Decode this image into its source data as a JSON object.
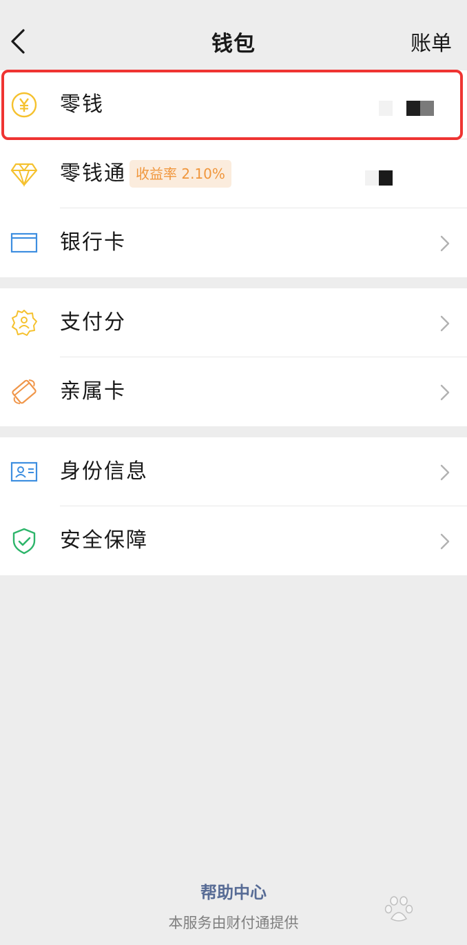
{
  "header": {
    "back_icon": "chevron-left-icon",
    "title": "钱包",
    "right_action": "账单"
  },
  "group1": {
    "change": {
      "label": "零钱",
      "icon": "yuan-coin-icon",
      "icon_color": "#f5c12e"
    },
    "licaitong": {
      "label": "零钱通",
      "icon": "diamond-icon",
      "icon_color": "#f5c12e",
      "badge": "收益率 2.10%"
    },
    "bank_card": {
      "label": "银行卡",
      "icon": "bank-card-icon",
      "icon_color": "#3d8ee0"
    }
  },
  "group2": {
    "pay_score": {
      "label": "支付分",
      "icon": "score-badge-icon",
      "icon_color": "#f5c12e"
    },
    "family_card": {
      "label": "亲属卡",
      "icon": "family-card-icon",
      "icon_color": "#f0964a"
    }
  },
  "group3": {
    "identity": {
      "label": "身份信息",
      "icon": "id-card-icon",
      "icon_color": "#3d8ee0"
    },
    "security": {
      "label": "安全保障",
      "icon": "shield-check-icon",
      "icon_color": "#2db56a"
    }
  },
  "footer": {
    "help_link": "帮助中心",
    "note": "本服务由财付通提供"
  },
  "colors": {
    "highlight_border": "#ef3432",
    "badge_bg": "#fbecdd",
    "badge_text": "#f0963c",
    "link": "#576b95",
    "page_bg": "#ededed"
  }
}
